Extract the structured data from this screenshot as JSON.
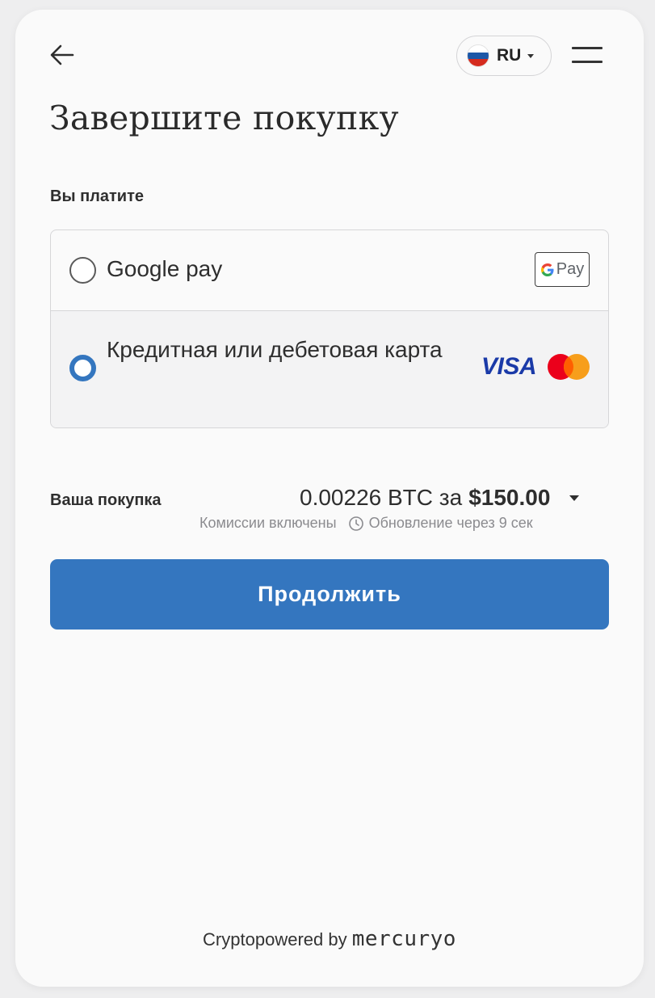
{
  "header": {
    "back_icon": "arrow-left-icon",
    "language": {
      "code": "RU",
      "flag_colors": [
        "#ffffff",
        "#1c57a7",
        "#d52b1e"
      ]
    },
    "menu_icon": "hamburger-menu-icon"
  },
  "page_title": "Завершите покупку",
  "payment": {
    "label": "Вы платите",
    "methods": [
      {
        "label": "Google pay",
        "selected": false,
        "badge_text": "Pay",
        "badge_icon": "google-g-icon"
      },
      {
        "label": "Кредитная или дебетовая карта",
        "selected": true,
        "brand_visa": "VISA",
        "brand_mastercard": "mastercard-icon"
      }
    ]
  },
  "purchase": {
    "label": "Ваша покупка",
    "crypto": "0.00226 BTC за",
    "fiat": "$150.00",
    "fees_note": "Комиссии включены",
    "refresh_note": "Обновление через 9 сек"
  },
  "continue_label": "Продолжить",
  "footer": {
    "prefix": "Cryptopowered by",
    "brand": "mercuryo"
  },
  "colors": {
    "accent": "#3476bf",
    "background": "#fafafa"
  }
}
